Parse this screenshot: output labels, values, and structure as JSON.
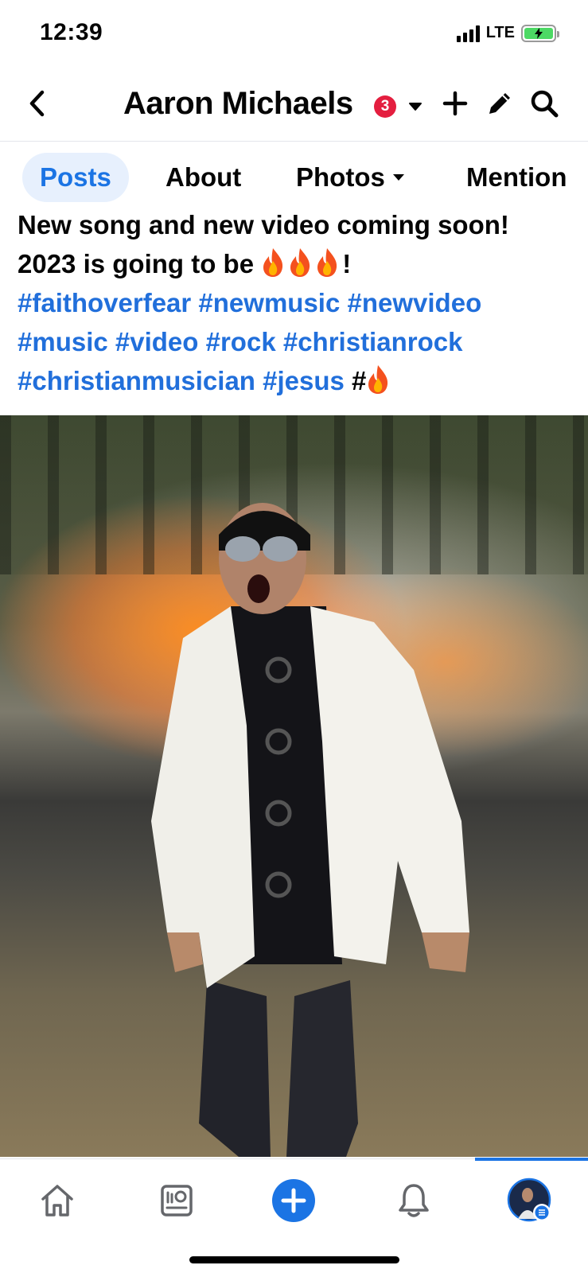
{
  "status_bar": {
    "time": "12:39",
    "network": "LTE",
    "battery_color": "#4cd964"
  },
  "header": {
    "page_name": "Aaron Michaels",
    "notification_count": "3",
    "icons": [
      "back-chevron-icon",
      "dropdown-caret-icon",
      "plus-icon",
      "pencil-icon",
      "search-icon"
    ]
  },
  "tabs": [
    {
      "label": "Posts",
      "active": true
    },
    {
      "label": "About",
      "active": false
    },
    {
      "label": "Photos",
      "active": false
    },
    {
      "label": "Mention",
      "active": false
    }
  ],
  "post": {
    "line1": "New song and new video coming soon!",
    "line2_prefix": "2023 is going to be",
    "line2_suffix": "!",
    "hashtags_line1": "#faithoverfear #newmusic #newvideo",
    "hashtags_line2": "#music #video #rock #christianrock",
    "hashtags_line3": "#christianmusician #jesus",
    "trailing_hash": "#"
  },
  "bottom_nav": {
    "items": [
      "home-icon",
      "feed-dashboard-icon",
      "create-plus-icon",
      "notifications-bell-icon",
      "profile-avatar"
    ],
    "active": "profile-avatar"
  },
  "colors": {
    "accent": "#1b74e4",
    "hashtag": "#216fdb",
    "badge": "#e41e3f",
    "tab_active_bg": "#e7f0fd"
  }
}
